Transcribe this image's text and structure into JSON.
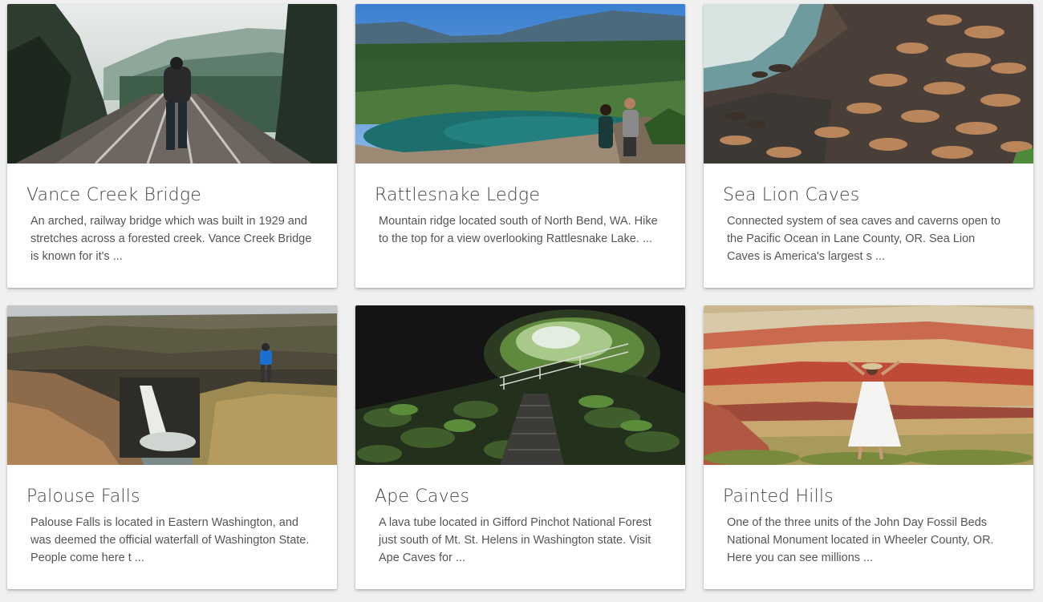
{
  "cards": [
    {
      "title": "Vance Creek Bridge",
      "description": "An arched, railway bridge which was built in 1929 and stretches across a forested creek. Vance Creek Bridge is known for it's ...",
      "image": "photo-railway-bridge-forest"
    },
    {
      "title": "Rattlesnake Ledge",
      "description": "Mountain ridge located south of North Bend, WA. Hike to the top for a view overlooking Rattlesnake Lake. ...",
      "image": "photo-lake-mountain-view"
    },
    {
      "title": "Sea Lion Caves",
      "description": "Connected system of sea caves and caverns open to the Pacific Ocean in Lane County, OR. Sea Lion Caves is America's largest s ...",
      "image": "photo-sea-lions-rocks"
    },
    {
      "title": "Palouse Falls",
      "description": "Palouse Falls is located in Eastern Washington, and was deemed the official waterfall of Washington State. People come here t ...",
      "image": "photo-waterfall-canyon"
    },
    {
      "title": "Ape Caves",
      "description": "A lava tube located in Gifford Pinchot National Forest just south of Mt. St. Helens in Washington state. Visit Ape Caves for ...",
      "image": "photo-lava-tube-cave"
    },
    {
      "title": "Painted Hills",
      "description": "One of the three units of the John Day Fossil Beds National Monument located in Wheeler County, OR. Here you can see millions ...",
      "image": "photo-painted-hills"
    }
  ]
}
